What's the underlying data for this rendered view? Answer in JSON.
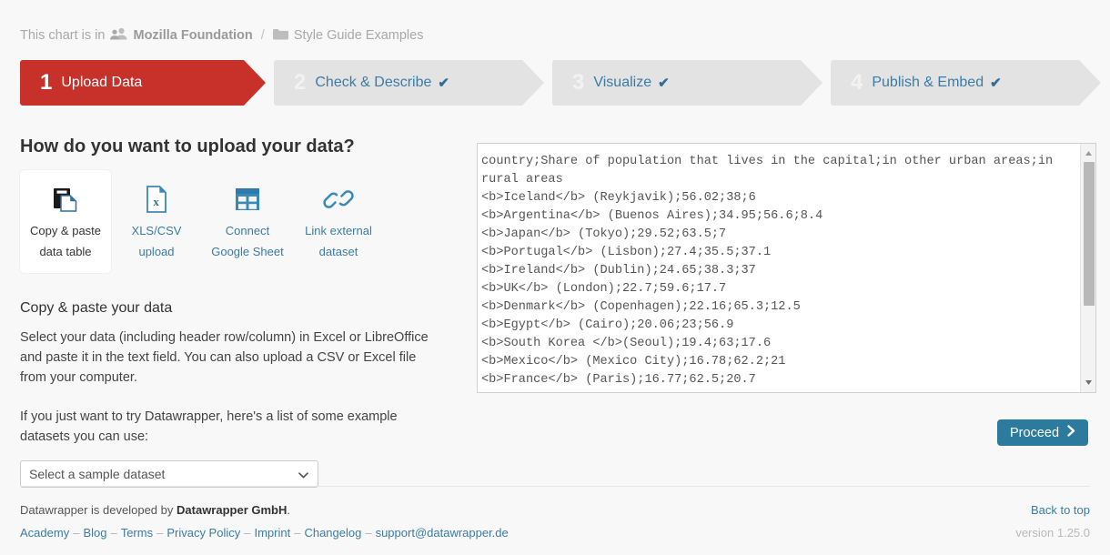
{
  "breadcrumb": {
    "lead": "This chart is in",
    "team_icon": "people-icon",
    "team": "Mozilla Foundation",
    "separator": "/",
    "folder_icon": "folder-icon",
    "folder": "Style Guide Examples"
  },
  "steps": [
    {
      "num": "1",
      "label": "Upload Data",
      "done": "",
      "active": true
    },
    {
      "num": "2",
      "label": "Check & Describe",
      "done": "✔",
      "active": false
    },
    {
      "num": "3",
      "label": "Visualize",
      "done": "✔",
      "active": false
    },
    {
      "num": "4",
      "label": "Publish & Embed",
      "done": "✔",
      "active": false
    }
  ],
  "upload": {
    "heading": "How do you want to upload your data?",
    "methods": [
      {
        "icon": "copy-paste-icon",
        "line1": "Copy & paste",
        "line2": "data table",
        "selected": true
      },
      {
        "icon": "xls-file-icon",
        "line1": "XLS/CSV",
        "line2": "upload",
        "selected": false
      },
      {
        "icon": "google-sheet-icon",
        "line1": "Connect",
        "line2": "Google Sheet",
        "selected": false
      },
      {
        "icon": "link-icon",
        "line1": "Link external",
        "line2": "dataset",
        "selected": false
      }
    ],
    "section_title": "Copy & paste your data",
    "description": "Select your data (including header row/column) in Excel or LibreOffice and paste it in the text field. You can also upload a CSV or Excel file from your computer.",
    "sample_intro": "If you just want to try Datawrapper, here's a list of some example datasets you can use:",
    "sample_select_value": "Select a sample dataset"
  },
  "data_textarea": {
    "value": "country;Share of population that lives in the capital;in other urban areas;in rural areas\n<b>Iceland</b> (Reykjavik);56.02;38;6\n<b>Argentina</b> (Buenos Aires);34.95;56.6;8.4\n<b>Japan</b> (Tokyo);29.52;63.5;7\n<b>Portugal</b> (Lisbon);27.4;35.5;37.1\n<b>Ireland</b> (Dublin);24.65;38.3;37\n<b>UK</b> (London);22.7;59.6;17.7\n<b>Denmark</b> (Copenhagen);22.16;65.3;12.5\n<b>Egypt</b> (Cairo);20.06;23;56.9\n<b>South Korea </b>(Seoul);19.4;63;17.6\n<b>Mexico</b> (Mexico City);16.78;62.2;21\n<b>France</b> (Paris);16.77;62.5;20.7",
    "scroll_up_icon": "triangle-up-icon",
    "scroll_down_icon": "triangle-down-icon"
  },
  "proceed": {
    "label": "Proceed",
    "icon": "chevron-right-icon"
  },
  "footer": {
    "credit_prefix": "Datawrapper is developed by",
    "credit_company": "Datawrapper GmbH",
    "credit_suffix": ".",
    "links": [
      "Academy",
      "Blog",
      "Terms",
      "Privacy Policy",
      "Imprint",
      "Changelog",
      "support@datawrapper.de"
    ],
    "back_to_top": "Back to top",
    "version": "version 1.25.0"
  },
  "colors": {
    "active_step": "#c8302a",
    "inactive_step": "#e3e3e3",
    "link_blue": "#3a7ca5",
    "proceed_button": "#2c7b9e",
    "page_bg": "#f8f8f8"
  }
}
